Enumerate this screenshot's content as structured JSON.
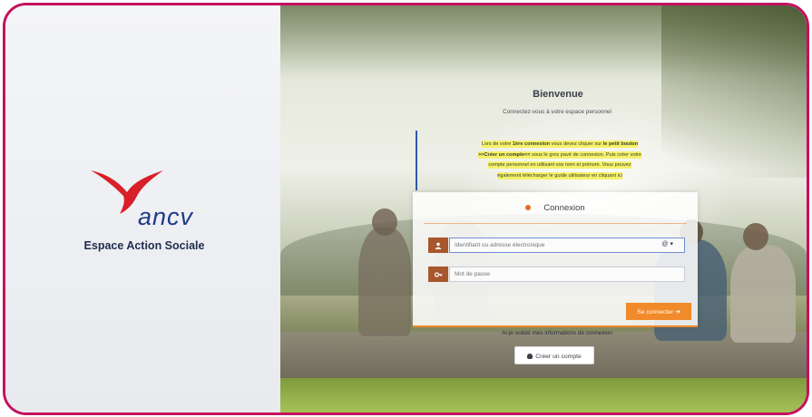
{
  "brand": {
    "logo_text": "ancv",
    "subtitle": "Espace Action Sociale",
    "colors": {
      "frame": "#c4115f",
      "bird": "#d81f2a",
      "logo_text": "#1e3a8a",
      "accent": "#f08a2a"
    }
  },
  "welcome": {
    "title": "Bienvenue",
    "subtitle": "Connectez-vous à votre espace personnel"
  },
  "notice": {
    "line1_a": "Lors de votre ",
    "line1_b": "1ère connexion",
    "line1_c": " vous devez cliquer sur ",
    "line1_d": "le petit  bouton",
    "line2_a": ">>Créer un compte<<",
    "line2_b": " sous le gros pavé de connexion. Puis créer votre",
    "line3": "compte personnel en utilisant vos nom et prénom. Vous pouvez",
    "line4": "également télécharger le guide utilisateur en cliquant ici"
  },
  "login": {
    "title": "Connexion",
    "title_icon": "user-icon",
    "identifier_placeholder": "Identifiant ou adresse électronique",
    "identifier_icon": "user-icon",
    "identifier_addon": "@ ▾",
    "password_placeholder": "Mot de passe",
    "password_icon": "key-icon",
    "connect_label": "Se connecter ➔"
  },
  "forgot_label": "Ai-je oublié mes informations de connexion",
  "create_account_label": "Créer un compte"
}
